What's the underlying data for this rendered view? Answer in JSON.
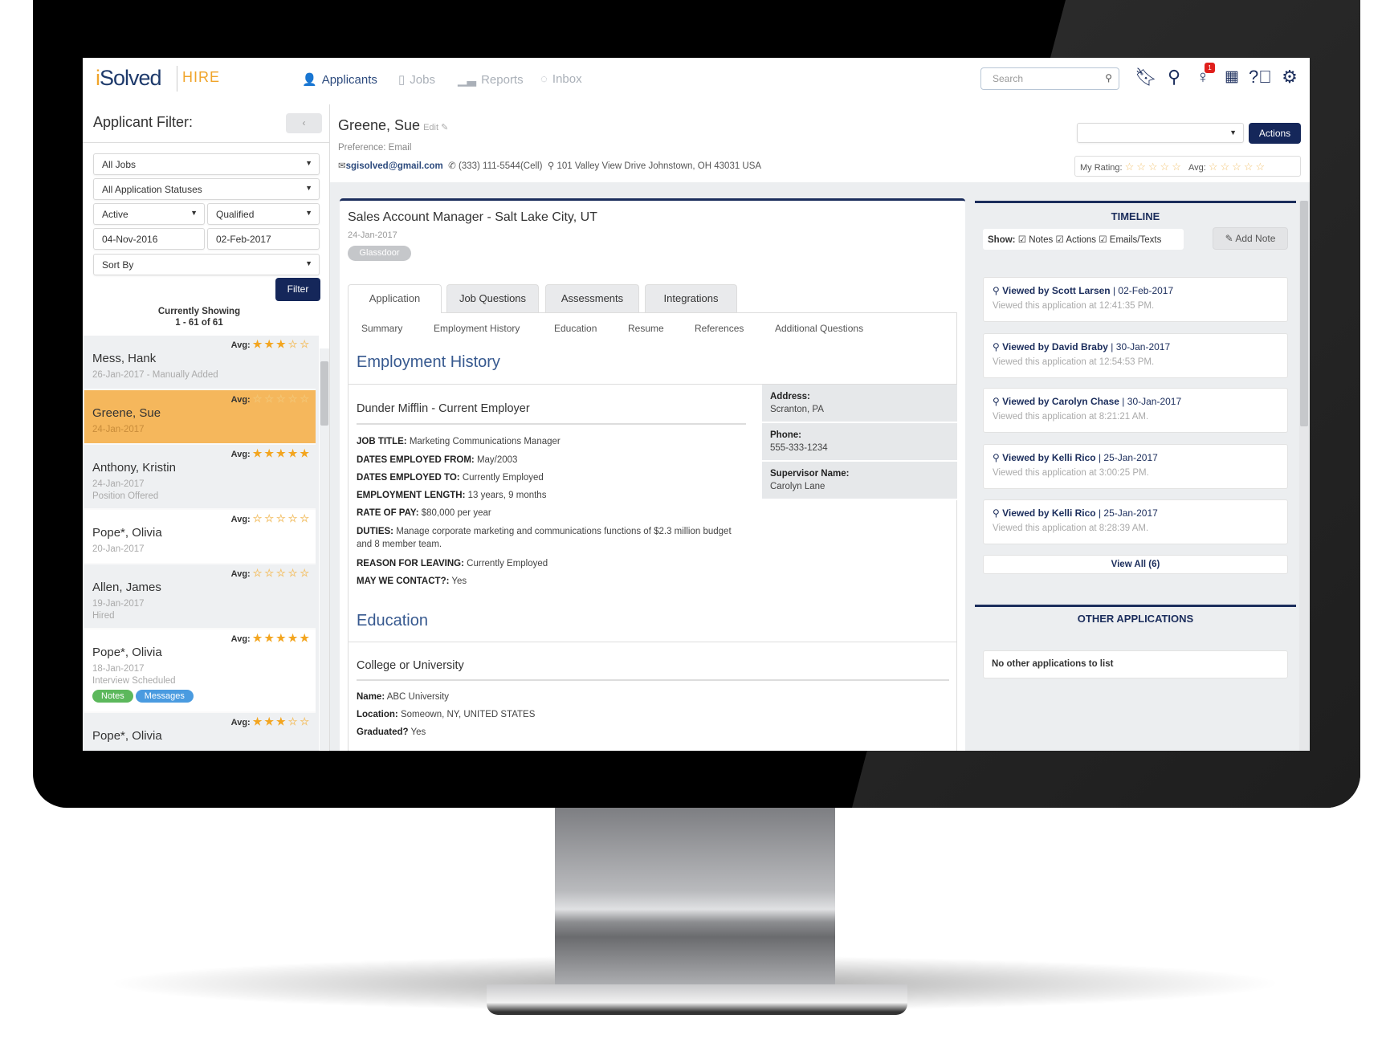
{
  "colors": {
    "navy": "#1b2d5c",
    "accent_orange": "#f0a42a",
    "selected_row": "#f5b75c",
    "notes_green": "#5cb85c",
    "messages_blue": "#4a9be0"
  },
  "header": {
    "logo": "iSolved",
    "logo_i": "i",
    "logo_rest": "Solved",
    "product": "HIRE",
    "nav": [
      {
        "label": "Applicants",
        "icon": "user-icon",
        "active": true
      },
      {
        "label": "Jobs",
        "icon": "document-icon"
      },
      {
        "label": "Reports",
        "icon": "bar-chart-icon"
      },
      {
        "label": "Inbox",
        "icon": "chat-icon"
      }
    ],
    "search_placeholder": "Search",
    "icons": [
      "bookmark-icon",
      "search-icon",
      "lightbulb-icon",
      "calendar-icon",
      "help-icon",
      "settings-icon"
    ],
    "notification_count": "1"
  },
  "filter": {
    "title": "Applicant Filter:",
    "collapse": "‹",
    "jobs": "All Jobs",
    "statuses": "All Application Statuses",
    "state": "Active",
    "qualification": "Qualified",
    "date_from": "04-Nov-2016",
    "date_to": "02-Feb-2017",
    "sort": "Sort By",
    "button": "Filter",
    "showing_label": "Currently Showing",
    "showing_range": "1 - 61 of 61"
  },
  "applicants": [
    {
      "name": "Mess, Hank",
      "lines": [
        "26-Jan-2017 - Manually Added"
      ],
      "rating": 3
    },
    {
      "name": "Greene, Sue",
      "lines": [
        "24-Jan-2017"
      ],
      "rating": 0,
      "selected": true
    },
    {
      "name": "Anthony, Kristin",
      "lines": [
        "24-Jan-2017",
        "Position Offered"
      ],
      "rating": 5
    },
    {
      "name": "Pope*, Olivia",
      "lines": [
        "20-Jan-2017"
      ],
      "rating": 0,
      "white": true
    },
    {
      "name": "Allen, James",
      "lines": [
        "19-Jan-2017",
        "Hired"
      ],
      "rating": 0
    },
    {
      "name": "Pope*, Olivia",
      "lines": [
        "18-Jan-2017",
        "Interview Scheduled"
      ],
      "rating": 5,
      "white": true,
      "pills": [
        "Notes",
        "Messages"
      ]
    },
    {
      "name": "Pope*, Olivia",
      "lines": [],
      "rating": 3
    }
  ],
  "avg_label": "Avg:",
  "candidate": {
    "name": "Greene, Sue",
    "edit": "Edit",
    "preference": "Preference: Email",
    "email": "sgisolved@gmail.com",
    "phone": "(333) 111-5544(Cell)",
    "address": "101 Valley View Drive Johnstown, OH 43031 USA",
    "actions_select": "",
    "actions_button": "Actions",
    "my_rating_label": "My Rating:",
    "my_rating": 0,
    "avg_label": "Avg:",
    "avg_rating": 0
  },
  "application": {
    "title": "Sales Account Manager - Salt Lake City, UT",
    "date": "24-Jan-2017",
    "source": "Glassdoor",
    "tabs": [
      "Application",
      "Job Questions",
      "Assessments",
      "Integrations"
    ],
    "subtabs": [
      "Summary",
      "Employment History",
      "Education",
      "Resume",
      "References",
      "Additional Questions"
    ],
    "employment_heading": "Employment History",
    "employer": "Dunder Mifflin - Current Employer",
    "fields": [
      {
        "k": "JOB TITLE:",
        "v": "Marketing Communications Manager"
      },
      {
        "k": "DATES EMPLOYED FROM:",
        "v": "May/2003"
      },
      {
        "k": "DATES EMPLOYED TO:",
        "v": "Currently Employed"
      },
      {
        "k": "EMPLOYMENT LENGTH:",
        "v": "13 years, 9 months"
      },
      {
        "k": "RATE OF PAY:",
        "v": "$80,000 per year"
      },
      {
        "k": "DUTIES:",
        "v": "Manage corporate marketing and communications functions of $2.3 million budget and 8 member team."
      },
      {
        "k": "REASON FOR LEAVING:",
        "v": "Currently Employed"
      },
      {
        "k": "MAY WE CONTACT?:",
        "v": "Yes"
      }
    ],
    "side": [
      {
        "k": "Address:",
        "v": "Scranton, PA"
      },
      {
        "k": "Phone:",
        "v": "555-333-1234"
      },
      {
        "k": "Supervisor Name:",
        "v": "Carolyn Lane"
      }
    ],
    "education_heading": "Education",
    "school_type": "College or University",
    "edu_fields": [
      {
        "k": "Name:",
        "v": "ABC University"
      },
      {
        "k": "Location:",
        "v": "Someown, NY, UNITED STATES"
      },
      {
        "k": "Graduated?",
        "v": "Yes"
      }
    ]
  },
  "timeline": {
    "title": "TIMELINE",
    "show_label": "Show:",
    "filters": [
      "Notes",
      "Actions",
      "Emails/Texts"
    ],
    "add_note": "Add Note",
    "items": [
      {
        "who": "Viewed by Scott Larsen",
        "date": "02-Feb-2017",
        "detail": "Viewed this application at 12:41:35 PM."
      },
      {
        "who": "Viewed by David Braby",
        "date": "30-Jan-2017",
        "detail": "Viewed this application at 12:54:53 PM."
      },
      {
        "who": "Viewed by Carolyn Chase",
        "date": "30-Jan-2017",
        "detail": "Viewed this application at 8:21:21 AM."
      },
      {
        "who": "Viewed by Kelli Rico",
        "date": "25-Jan-2017",
        "detail": "Viewed this application at 3:00:25 PM."
      },
      {
        "who": "Viewed by Kelli Rico",
        "date": "25-Jan-2017",
        "detail": "Viewed this application at 8:28:39 AM."
      }
    ],
    "view_all": "View All (6)"
  },
  "other_applications": {
    "title": "OTHER APPLICATIONS",
    "empty": "No other applications to list"
  }
}
